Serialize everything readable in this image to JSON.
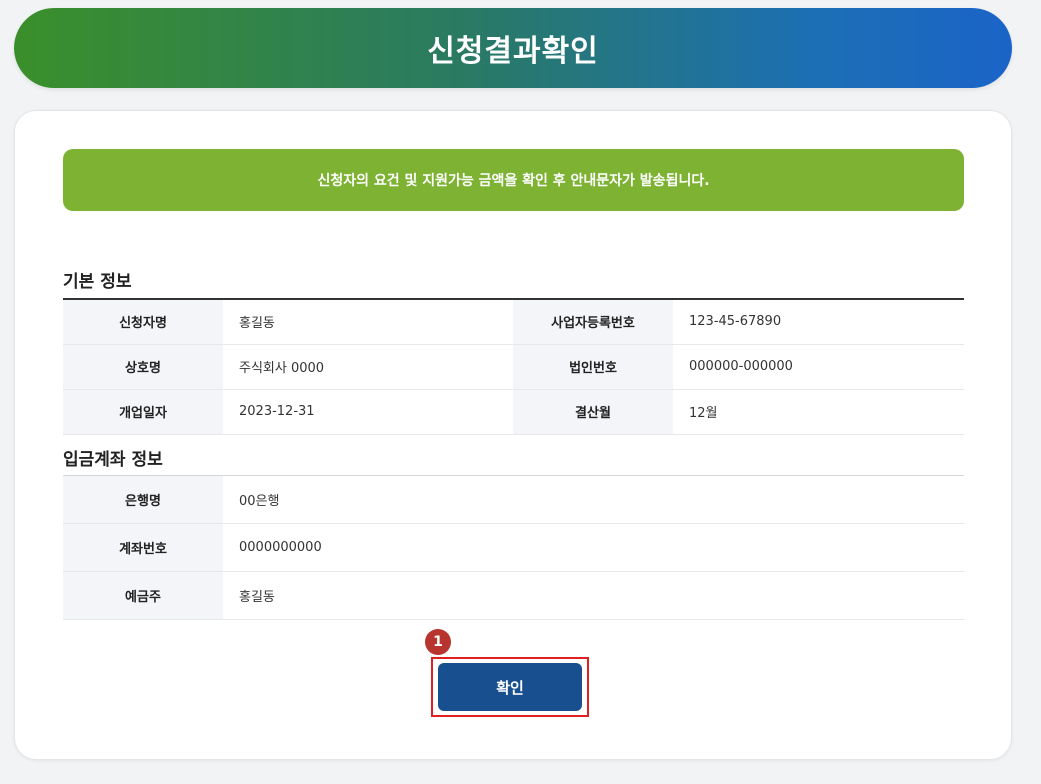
{
  "header": {
    "title": "신청결과확인"
  },
  "notice": {
    "text": "신청자의 요건 및 지원가능 금액을 확인 후 안내문자가 발송됩니다."
  },
  "basic_info": {
    "title": "기본 정보",
    "rows": [
      {
        "label1": "신청자명",
        "value1": "홍길동",
        "label2": "사업자등록번호",
        "value2": "123-45-67890"
      },
      {
        "label1": "상호명",
        "value1": "주식회사 0000",
        "label2": "법인번호",
        "value2": "000000-000000"
      },
      {
        "label1": "개업일자",
        "value1": "2023-12-31",
        "label2": "결산월",
        "value2": "12월"
      }
    ]
  },
  "account_info": {
    "title": "입금계좌 정보",
    "rows": [
      {
        "label": "은행명",
        "value": "00은행"
      },
      {
        "label": "계좌번호",
        "value": "0000000000"
      },
      {
        "label": "예금주",
        "value": "홍길동"
      }
    ]
  },
  "step_badge": "1",
  "confirm_button": {
    "label": "확인"
  }
}
